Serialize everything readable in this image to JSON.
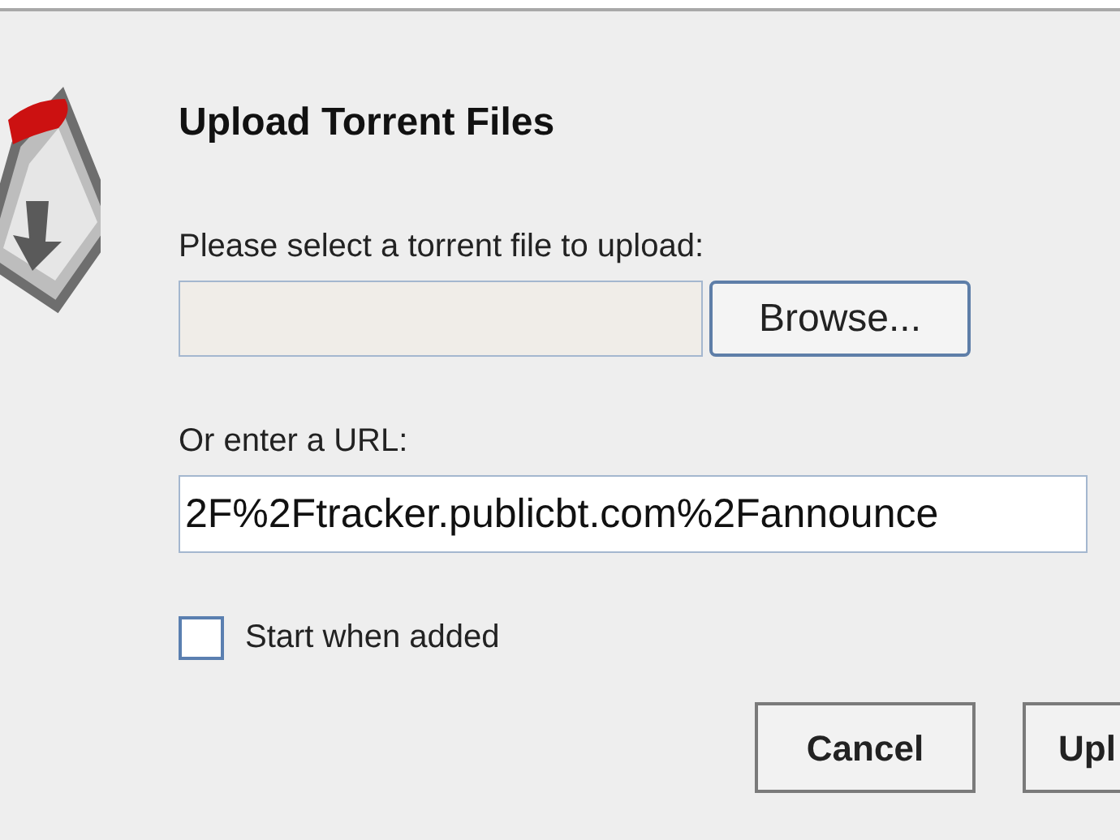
{
  "dialog": {
    "title": "Upload Torrent Files"
  },
  "file_section": {
    "label": "Please select a torrent file to upload:",
    "browse_button": "Browse..."
  },
  "url_section": {
    "label": "Or enter a URL:",
    "value": "2F%2Ftracker.publicbt.com%2Fannounce"
  },
  "start_option": {
    "label": "Start when added",
    "checked": false
  },
  "buttons": [
    "Cancel",
    "Upl"
  ]
}
